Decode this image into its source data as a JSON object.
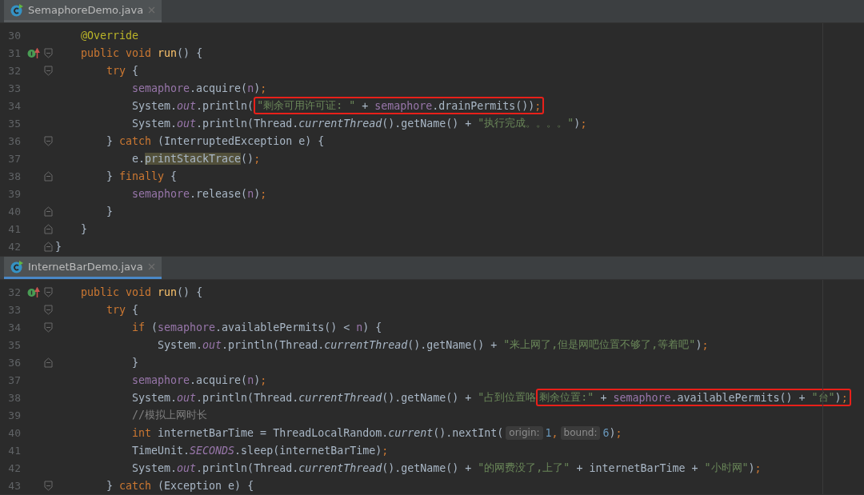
{
  "panes": [
    {
      "tab": {
        "title": "SemaphoreDemo.java",
        "selected": true,
        "focused": false
      },
      "lines": [
        {
          "number": "30",
          "parts": [
            {
              "kind": "code",
              "boxed": false,
              "tokens": [
                {
                  "kind": "anno",
                  "text": "    @Override"
                }
              ]
            }
          ]
        },
        {
          "number": "31",
          "marker": {
            "kind": "override"
          },
          "fold": {
            "kind": "open"
          },
          "parts": [
            {
              "kind": "code",
              "boxed": false,
              "tokens": [
                {
                  "kind": "kw",
                  "text": "    public void "
                },
                {
                  "kind": "fn",
                  "text": "run"
                },
                {
                  "kind": "plain",
                  "text": "() {"
                }
              ]
            }
          ]
        },
        {
          "number": "32",
          "fold": {
            "kind": "open"
          },
          "parts": [
            {
              "kind": "code",
              "boxed": false,
              "tokens": [
                {
                  "kind": "kw",
                  "text": "        try"
                },
                {
                  "kind": "plain",
                  "text": " {"
                }
              ]
            }
          ]
        },
        {
          "number": "33",
          "parts": [
            {
              "kind": "code",
              "boxed": false,
              "tokens": [
                {
                  "kind": "field",
                  "text": "            semaphore"
                },
                {
                  "kind": "plain",
                  "text": ".acquire("
                },
                {
                  "kind": "field",
                  "text": "n"
                },
                {
                  "kind": "plain",
                  "text": ")"
                },
                {
                  "kind": "kw",
                  "text": ";"
                }
              ]
            }
          ]
        },
        {
          "number": "34",
          "parts": [
            {
              "kind": "code",
              "boxed": false,
              "tokens": [
                {
                  "kind": "plain",
                  "text": "            System."
                },
                {
                  "kind": "static",
                  "text": "out"
                },
                {
                  "kind": "plain",
                  "text": ".println("
                }
              ]
            },
            {
              "kind": "code",
              "boxed": true,
              "tokens": [
                {
                  "kind": "str",
                  "text": "\"剩余可用许可证: \""
                },
                {
                  "kind": "plain",
                  "text": " + "
                },
                {
                  "kind": "field",
                  "text": "semaphore"
                },
                {
                  "kind": "plain",
                  "text": ".drainPermits())"
                },
                {
                  "kind": "kw",
                  "text": ";"
                }
              ]
            }
          ]
        },
        {
          "number": "35",
          "parts": [
            {
              "kind": "code",
              "boxed": false,
              "tokens": [
                {
                  "kind": "plain",
                  "text": "            System."
                },
                {
                  "kind": "static",
                  "text": "out"
                },
                {
                  "kind": "plain",
                  "text": ".println(Thread."
                },
                {
                  "kind": "italic",
                  "text": "currentThread"
                },
                {
                  "kind": "plain",
                  "text": "().getName() + "
                },
                {
                  "kind": "str",
                  "text": "\"执行完成。。。。\""
                },
                {
                  "kind": "plain",
                  "text": ")"
                },
                {
                  "kind": "kw",
                  "text": ";"
                }
              ]
            }
          ]
        },
        {
          "number": "36",
          "fold": {
            "kind": "open"
          },
          "parts": [
            {
              "kind": "code",
              "boxed": false,
              "tokens": [
                {
                  "kind": "plain",
                  "text": "        } "
                },
                {
                  "kind": "kw",
                  "text": "catch"
                },
                {
                  "kind": "plain",
                  "text": " (InterruptedException e) {"
                }
              ]
            }
          ]
        },
        {
          "number": "37",
          "parts": [
            {
              "kind": "code",
              "boxed": false,
              "tokens": [
                {
                  "kind": "plain",
                  "text": "            e."
                },
                {
                  "kind": "usage",
                  "text": "printStackTrace"
                },
                {
                  "kind": "plain",
                  "text": "()"
                },
                {
                  "kind": "kw",
                  "text": ";"
                }
              ]
            }
          ]
        },
        {
          "number": "38",
          "fold": {
            "kind": "close"
          },
          "parts": [
            {
              "kind": "code",
              "boxed": false,
              "tokens": [
                {
                  "kind": "plain",
                  "text": "        } "
                },
                {
                  "kind": "kw",
                  "text": "finally"
                },
                {
                  "kind": "plain",
                  "text": " {"
                }
              ]
            }
          ]
        },
        {
          "number": "39",
          "parts": [
            {
              "kind": "code",
              "boxed": false,
              "tokens": [
                {
                  "kind": "field",
                  "text": "            semaphore"
                },
                {
                  "kind": "plain",
                  "text": ".release("
                },
                {
                  "kind": "field",
                  "text": "n"
                },
                {
                  "kind": "plain",
                  "text": ")"
                },
                {
                  "kind": "kw",
                  "text": ";"
                }
              ]
            }
          ]
        },
        {
          "number": "40",
          "fold": {
            "kind": "close"
          },
          "parts": [
            {
              "kind": "code",
              "boxed": false,
              "tokens": [
                {
                  "kind": "plain",
                  "text": "        }"
                }
              ]
            }
          ]
        },
        {
          "number": "41",
          "fold": {
            "kind": "close"
          },
          "parts": [
            {
              "kind": "code",
              "boxed": false,
              "tokens": [
                {
                  "kind": "plain",
                  "text": "    }"
                }
              ]
            }
          ]
        },
        {
          "number": "42",
          "fold": {
            "kind": "close"
          },
          "parts": [
            {
              "kind": "code",
              "boxed": false,
              "tokens": [
                {
                  "kind": "plain",
                  "text": "}"
                }
              ]
            }
          ]
        }
      ]
    },
    {
      "tab": {
        "title": "InternetBarDemo.java",
        "selected": true,
        "focused": true
      },
      "lines": [
        {
          "number": "32",
          "marker": {
            "kind": "override"
          },
          "fold": {
            "kind": "open"
          },
          "parts": [
            {
              "kind": "code",
              "boxed": false,
              "tokens": [
                {
                  "kind": "kw",
                  "text": "    public void "
                },
                {
                  "kind": "fn",
                  "text": "run"
                },
                {
                  "kind": "plain",
                  "text": "() {"
                }
              ]
            }
          ]
        },
        {
          "number": "33",
          "fold": {
            "kind": "open"
          },
          "parts": [
            {
              "kind": "code",
              "boxed": false,
              "tokens": [
                {
                  "kind": "kw",
                  "text": "        try"
                },
                {
                  "kind": "plain",
                  "text": " {"
                }
              ]
            }
          ]
        },
        {
          "number": "34",
          "fold": {
            "kind": "open"
          },
          "parts": [
            {
              "kind": "code",
              "boxed": false,
              "tokens": [
                {
                  "kind": "kw",
                  "text": "            if"
                },
                {
                  "kind": "plain",
                  "text": " ("
                },
                {
                  "kind": "field",
                  "text": "semaphore"
                },
                {
                  "kind": "plain",
                  "text": ".availablePermits() < "
                },
                {
                  "kind": "field",
                  "text": "n"
                },
                {
                  "kind": "plain",
                  "text": ") {"
                }
              ]
            }
          ]
        },
        {
          "number": "35",
          "parts": [
            {
              "kind": "code",
              "boxed": false,
              "tokens": [
                {
                  "kind": "plain",
                  "text": "                System."
                },
                {
                  "kind": "static",
                  "text": "out"
                },
                {
                  "kind": "plain",
                  "text": ".println(Thread."
                },
                {
                  "kind": "italic",
                  "text": "currentThread"
                },
                {
                  "kind": "plain",
                  "text": "().getName() + "
                },
                {
                  "kind": "str",
                  "text": "\"来上网了,但是网吧位置不够了,等着吧\""
                },
                {
                  "kind": "plain",
                  "text": ")"
                },
                {
                  "kind": "kw",
                  "text": ";"
                }
              ]
            }
          ]
        },
        {
          "number": "36",
          "fold": {
            "kind": "close"
          },
          "parts": [
            {
              "kind": "code",
              "boxed": false,
              "tokens": [
                {
                  "kind": "plain",
                  "text": "            }"
                }
              ]
            }
          ]
        },
        {
          "number": "37",
          "parts": [
            {
              "kind": "code",
              "boxed": false,
              "tokens": [
                {
                  "kind": "field",
                  "text": "            semaphore"
                },
                {
                  "kind": "plain",
                  "text": ".acquire("
                },
                {
                  "kind": "field",
                  "text": "n"
                },
                {
                  "kind": "plain",
                  "text": ")"
                },
                {
                  "kind": "kw",
                  "text": ";"
                }
              ]
            }
          ]
        },
        {
          "number": "38",
          "parts": [
            {
              "kind": "code",
              "boxed": false,
              "tokens": [
                {
                  "kind": "plain",
                  "text": "            System."
                },
                {
                  "kind": "static",
                  "text": "out"
                },
                {
                  "kind": "plain",
                  "text": ".println(Thread."
                },
                {
                  "kind": "italic",
                  "text": "currentThread"
                },
                {
                  "kind": "plain",
                  "text": "().getName() + "
                },
                {
                  "kind": "str",
                  "text": "\"占到位置咯"
                }
              ]
            },
            {
              "kind": "code",
              "boxed": true,
              "tokens": [
                {
                  "kind": "str",
                  "text": "剩余位置:\""
                },
                {
                  "kind": "plain",
                  "text": " + "
                },
                {
                  "kind": "field",
                  "text": "semaphore"
                },
                {
                  "kind": "plain",
                  "text": ".availablePermits() + "
                },
                {
                  "kind": "str",
                  "text": "\"台\""
                },
                {
                  "kind": "plain",
                  "text": ")"
                },
                {
                  "kind": "kw",
                  "text": ";"
                }
              ]
            }
          ]
        },
        {
          "number": "39",
          "parts": [
            {
              "kind": "code",
              "boxed": false,
              "tokens": [
                {
                  "kind": "comment",
                  "text": "            //模拟上网时长"
                }
              ]
            }
          ]
        },
        {
          "number": "40",
          "parts": [
            {
              "kind": "code",
              "boxed": false,
              "tokens": [
                {
                  "kind": "kw",
                  "text": "            int"
                },
                {
                  "kind": "plain",
                  "text": " internetBarTime = ThreadLocalRandom."
                },
                {
                  "kind": "italic",
                  "text": "current"
                },
                {
                  "kind": "plain",
                  "text": "().nextInt("
                }
              ]
            },
            {
              "kind": "hint",
              "text": "origin:"
            },
            {
              "kind": "code",
              "boxed": false,
              "tokens": [
                {
                  "kind": "num",
                  "text": "1"
                },
                {
                  "kind": "kw",
                  "text": ","
                }
              ]
            },
            {
              "kind": "hint",
              "text": "bound:"
            },
            {
              "kind": "code",
              "boxed": false,
              "tokens": [
                {
                  "kind": "num",
                  "text": "6"
                },
                {
                  "kind": "plain",
                  "text": ")"
                },
                {
                  "kind": "kw",
                  "text": ";"
                }
              ]
            }
          ]
        },
        {
          "number": "41",
          "parts": [
            {
              "kind": "code",
              "boxed": false,
              "tokens": [
                {
                  "kind": "plain",
                  "text": "            TimeUnit."
                },
                {
                  "kind": "static",
                  "text": "SECONDS"
                },
                {
                  "kind": "plain",
                  "text": ".sleep(internetBarTime)"
                },
                {
                  "kind": "kw",
                  "text": ";"
                }
              ]
            }
          ]
        },
        {
          "number": "42",
          "parts": [
            {
              "kind": "code",
              "boxed": false,
              "tokens": [
                {
                  "kind": "plain",
                  "text": "            System."
                },
                {
                  "kind": "static",
                  "text": "out"
                },
                {
                  "kind": "plain",
                  "text": ".println(Thread."
                },
                {
                  "kind": "italic",
                  "text": "currentThread"
                },
                {
                  "kind": "plain",
                  "text": "().getName() + "
                },
                {
                  "kind": "str",
                  "text": "\"的网费没了,上了\""
                },
                {
                  "kind": "plain",
                  "text": " + internetBarTime + "
                },
                {
                  "kind": "str",
                  "text": "\"小时网\""
                },
                {
                  "kind": "plain",
                  "text": ")"
                },
                {
                  "kind": "kw",
                  "text": ";"
                }
              ]
            }
          ]
        },
        {
          "number": "43",
          "fold": {
            "kind": "open"
          },
          "parts": [
            {
              "kind": "code",
              "boxed": false,
              "tokens": [
                {
                  "kind": "plain",
                  "text": "        } "
                },
                {
                  "kind": "kw",
                  "text": "catch"
                },
                {
                  "kind": "plain",
                  "text": " (Exception e) {"
                }
              ]
            }
          ]
        }
      ]
    }
  ]
}
